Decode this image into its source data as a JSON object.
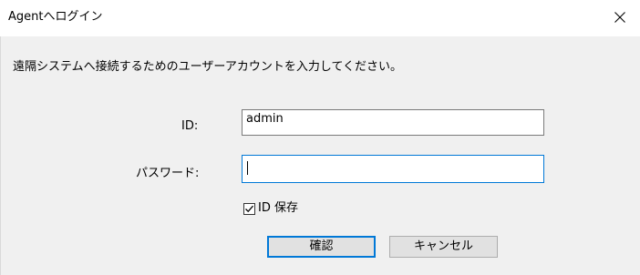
{
  "window": {
    "title": "Agentへログイン",
    "close_icon": "close-icon"
  },
  "dialog": {
    "message": "遠隔システムへ接続するためのユーザーアカウントを入力してください。",
    "id_label": "ID:",
    "id_value": "admin",
    "password_label": "パスワード:",
    "password_value": "",
    "save_id_label": "ID 保存",
    "save_id_checked": true,
    "ok_label": "確認",
    "cancel_label": "キャンセル"
  },
  "colors": {
    "focus_border": "#0078d7",
    "client_background": "#f0f0f0",
    "button_background": "#e1e1e1"
  }
}
